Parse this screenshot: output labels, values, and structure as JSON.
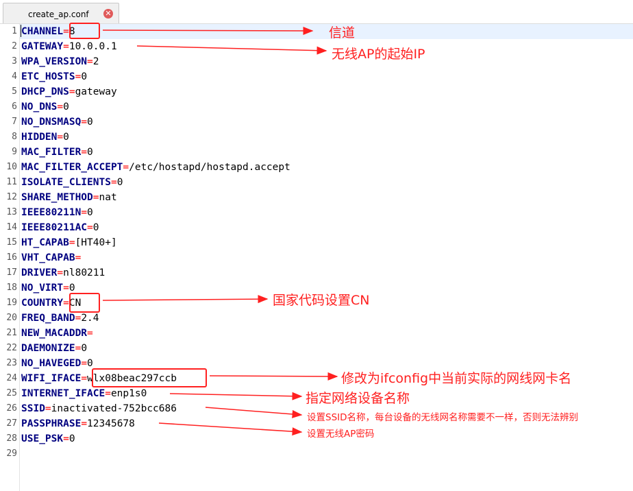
{
  "tab": {
    "filename": "create_ap.conf",
    "close_glyph": "✕"
  },
  "colors": {
    "key": "#000080",
    "equals": "#ff0000",
    "annotation": "#ff2020"
  },
  "lines": [
    {
      "no": "1",
      "key": "CHANNEL",
      "eq": "=",
      "value": "8"
    },
    {
      "no": "2",
      "key": "GATEWAY",
      "eq": "=",
      "value": "10.0.0.1"
    },
    {
      "no": "3",
      "key": "WPA_VERSION",
      "eq": "=",
      "value": "2"
    },
    {
      "no": "4",
      "key": "ETC_HOSTS",
      "eq": "=",
      "value": "0"
    },
    {
      "no": "5",
      "key": "DHCP_DNS",
      "eq": "=",
      "value": "gateway"
    },
    {
      "no": "6",
      "key": "NO_DNS",
      "eq": "=",
      "value": "0"
    },
    {
      "no": "7",
      "key": "NO_DNSMASQ",
      "eq": "=",
      "value": "0"
    },
    {
      "no": "8",
      "key": "HIDDEN",
      "eq": "=",
      "value": "0"
    },
    {
      "no": "9",
      "key": "MAC_FILTER",
      "eq": "=",
      "value": "0"
    },
    {
      "no": "10",
      "key": "MAC_FILTER_ACCEPT",
      "eq": "=",
      "value": "/etc/hostapd/hostapd.accept"
    },
    {
      "no": "11",
      "key": "ISOLATE_CLIENTS",
      "eq": "=",
      "value": "0"
    },
    {
      "no": "12",
      "key": "SHARE_METHOD",
      "eq": "=",
      "value": "nat"
    },
    {
      "no": "13",
      "key": "IEEE80211N",
      "eq": "=",
      "value": "0"
    },
    {
      "no": "14",
      "key": "IEEE80211AC",
      "eq": "=",
      "value": "0"
    },
    {
      "no": "15",
      "key": "HT_CAPAB",
      "eq": "=",
      "value": "[HT40+]"
    },
    {
      "no": "16",
      "key": "VHT_CAPAB",
      "eq": "=",
      "value": ""
    },
    {
      "no": "17",
      "key": "DRIVER",
      "eq": "=",
      "value": "nl80211"
    },
    {
      "no": "18",
      "key": "NO_VIRT",
      "eq": "=",
      "value": "0"
    },
    {
      "no": "19",
      "key": "COUNTRY",
      "eq": "=",
      "value": "CN"
    },
    {
      "no": "20",
      "key": "FREQ_BAND",
      "eq": "=",
      "value": "2.4"
    },
    {
      "no": "21",
      "key": "NEW_MACADDR",
      "eq": "=",
      "value": ""
    },
    {
      "no": "22",
      "key": "DAEMONIZE",
      "eq": "=",
      "value": "0"
    },
    {
      "no": "23",
      "key": "NO_HAVEGED",
      "eq": "=",
      "value": "0"
    },
    {
      "no": "24",
      "key": "WIFI_IFACE",
      "eq": "=",
      "value": "wlx08beac297ccb"
    },
    {
      "no": "25",
      "key": "INTERNET_IFACE",
      "eq": "=",
      "value": "enp1s0"
    },
    {
      "no": "26",
      "key": "SSID",
      "eq": "=",
      "value": "inactivated-752bcc686"
    },
    {
      "no": "27",
      "key": "PASSPHRASE",
      "eq": "=",
      "value": "12345678"
    },
    {
      "no": "28",
      "key": "USE_PSK",
      "eq": "=",
      "value": "0"
    },
    {
      "no": "29",
      "key": "",
      "eq": "",
      "value": ""
    }
  ],
  "annotations": {
    "channel": "信道",
    "gateway": "无线AP的起始IP",
    "country": "国家代码设置CN",
    "wifi_iface": "修改为ifconfig中当前实际的网线网卡名",
    "internet_iface": "指定网络设备名称",
    "ssid": "设置SSID名称，每台设备的无线网名称需要不一样，否则无法辨别",
    "passphrase": "设置无线AP密码"
  }
}
